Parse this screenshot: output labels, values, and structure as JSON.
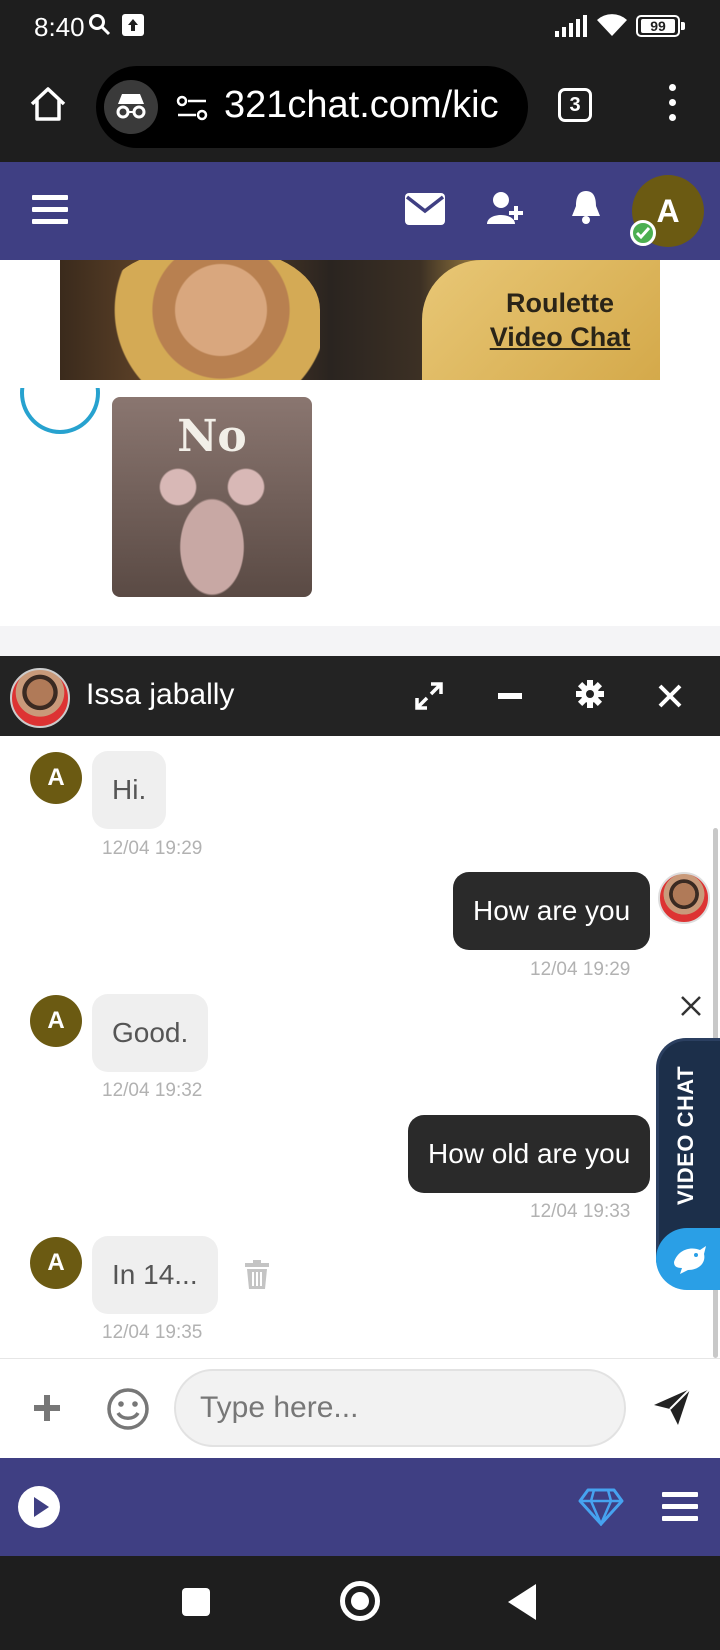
{
  "status_bar": {
    "time": "8:40",
    "battery": "99"
  },
  "browser": {
    "url": "321chat.com/kic",
    "tab_count": "3"
  },
  "banner": {
    "line1": "Roulette",
    "line2": "Video Chat"
  },
  "feed": {
    "image_caption": "No"
  },
  "header": {
    "user_initial": "A"
  },
  "chat": {
    "peer_name": "Issa jabally",
    "messages": [
      {
        "direction": "in",
        "sender_initial": "A",
        "text": "Hi.",
        "time": "12/04 19:29"
      },
      {
        "direction": "out",
        "text": "How are you",
        "time": "12/04 19:29"
      },
      {
        "direction": "in",
        "sender_initial": "A",
        "text": "Good.",
        "time": "12/04 19:32"
      },
      {
        "direction": "out",
        "text": "How old are you",
        "time": "12/04 19:33"
      },
      {
        "direction": "in",
        "sender_initial": "A",
        "text": "In 14...",
        "time": "12/04 19:35"
      }
    ],
    "input_placeholder": "Type here..."
  },
  "video_chat_tab": {
    "label": "VIDEO CHAT"
  },
  "colors": {
    "site_primary": "#3f3f83",
    "chat_header": "#232323",
    "avatar_a": "#6b5a12",
    "bubble_out": "#2a2a2a",
    "bubble_in": "#efefef"
  }
}
